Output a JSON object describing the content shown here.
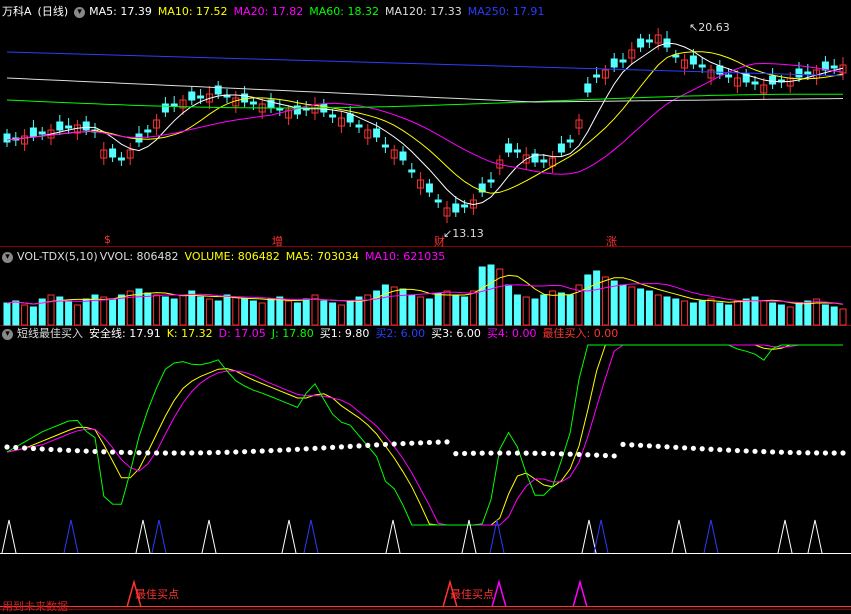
{
  "panel1": {
    "stock_name": "万科A",
    "period": "(日线)",
    "indicators": [
      {
        "label": "MA5: 17.39",
        "color": "#ffffff"
      },
      {
        "label": "MA10: 17.52",
        "color": "#ffff00"
      },
      {
        "label": "MA20: 17.82",
        "color": "#ff00ff"
      },
      {
        "label": "MA60: 18.32",
        "color": "#00ff00"
      },
      {
        "label": "MA120: 17.33",
        "color": "#dddddd"
      },
      {
        "label": "MA250: 17.91",
        "color": "#2b3cff"
      }
    ],
    "high_label": "20.63",
    "low_label": "13.13",
    "event_marks": [
      "$",
      "增",
      "财",
      "涨"
    ]
  },
  "panel2": {
    "indicator_name": "VOL-TDX(5,10)",
    "values": [
      {
        "label": "VVOL: 806482",
        "color": "#dddddd"
      },
      {
        "label": "VOLUME: 806482",
        "color": "#ffff00"
      },
      {
        "label": "MA5: 703034",
        "color": "#ffff00"
      },
      {
        "label": "MA10: 621035",
        "color": "#ff00ff"
      }
    ]
  },
  "panel3": {
    "indicator_name": "短线最佳买入",
    "values": [
      {
        "label": "安全线: 17.91",
        "color": "#ffffff"
      },
      {
        "label": "K: 17.32",
        "color": "#ffff00"
      },
      {
        "label": "D: 17.05",
        "color": "#ff00ff"
      },
      {
        "label": "J: 17.80",
        "color": "#00ff00"
      },
      {
        "label": "买1: 9.80",
        "color": "#ffffff"
      },
      {
        "label": "买2: 6.00",
        "color": "#2b3cff"
      },
      {
        "label": "买3: 6.00",
        "color": "#ffffff"
      },
      {
        "label": "买4: 0.00",
        "color": "#ff00ff"
      },
      {
        "label": "最佳买入: 0.00",
        "color": "#ff3333"
      }
    ],
    "best_buy_label": "最佳买点",
    "footer_note": "用到未来数据"
  },
  "colors": {
    "up": "#ff3333",
    "down": "#54ffff",
    "grid": "#8b0000"
  }
}
